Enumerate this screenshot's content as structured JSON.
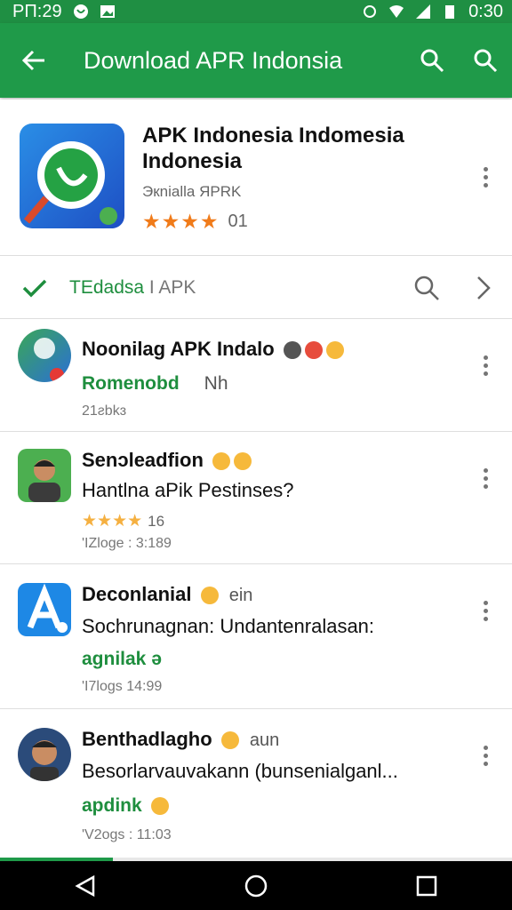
{
  "status_bar": {
    "time_left": "PΠ:29",
    "time_right": "0:30"
  },
  "app_bar": {
    "title": "Download APR Indonsia"
  },
  "app_header": {
    "title": "APK Indonesia Indomesia Indonesia",
    "subtitle": "Экnialla ЯPRK",
    "stars": "★★★★",
    "rating_count": "01"
  },
  "filter": {
    "label_green": "TEdadsa",
    "label_gray": "I APK"
  },
  "reviews": [
    {
      "name": "Noonilag APK Indalo",
      "text": "",
      "green": "Romenobd",
      "green_extra": "Nh",
      "meta": "21ƨbkɜ",
      "stars": "",
      "star_count": ""
    },
    {
      "name": "Senɔleadfion",
      "text": "Hantlna aPik Pestinses?",
      "green": "",
      "green_extra": "",
      "meta": "'IZloge : 3:189",
      "stars": "★★★★",
      "star_count": "16"
    },
    {
      "name": "Deconlanial",
      "name_extra": "ein",
      "text": "Sochrunagnan: Undantenralasan:",
      "green": "agnilak ə",
      "green_extra": "",
      "meta": "'I7logs 14:99",
      "stars": "",
      "star_count": ""
    },
    {
      "name": "Benthadlagho",
      "name_extra": "aun",
      "text": "Besorlarvauvakann (bunsenialganl...",
      "green": "apdink",
      "green_extra": "",
      "meta": "'V2ogs : 11:03",
      "stars": "",
      "star_count": ""
    }
  ],
  "download_progress": 0.22,
  "colors": {
    "brand_green": "#1f9a49",
    "star_orange": "#f07b1a",
    "text_green": "#1e8e3e"
  }
}
